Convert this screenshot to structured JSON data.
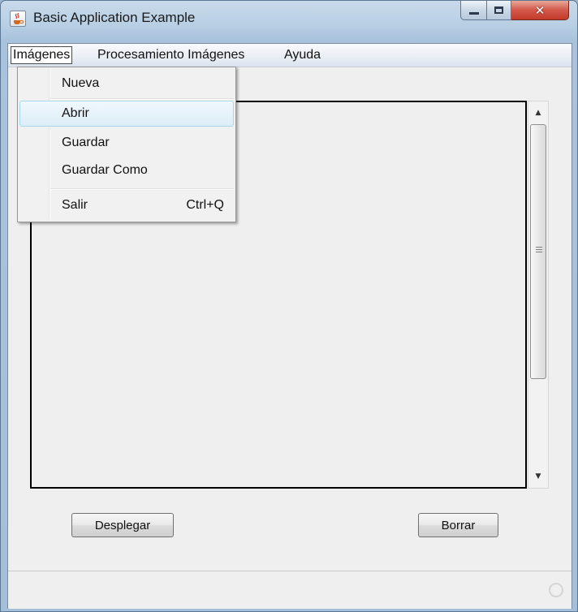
{
  "window": {
    "title": "Basic Application Example",
    "icon": "java-cup-icon",
    "controls": {
      "minimize": "minimize-icon",
      "maximize": "maximize-icon",
      "close": "✕"
    },
    "accent_close": "#c33a2a"
  },
  "menubar": {
    "items": [
      {
        "label": "Imágenes",
        "open": true
      },
      {
        "label": "Procesamiento Imágenes"
      },
      {
        "label": "Ayuda"
      }
    ]
  },
  "dropdown": {
    "items": [
      {
        "label": "Nueva"
      },
      {
        "label": "Abrir",
        "highlighted": true
      },
      {
        "label": "Guardar"
      },
      {
        "label": "Guardar Como"
      },
      {
        "label": "Salir",
        "accelerator": "Ctrl+Q"
      }
    ]
  },
  "buttons": {
    "desplegar": "Desplegar",
    "borrar": "Borrar"
  },
  "statusbar": {
    "busy_icon": "busy-indicator-icon"
  }
}
